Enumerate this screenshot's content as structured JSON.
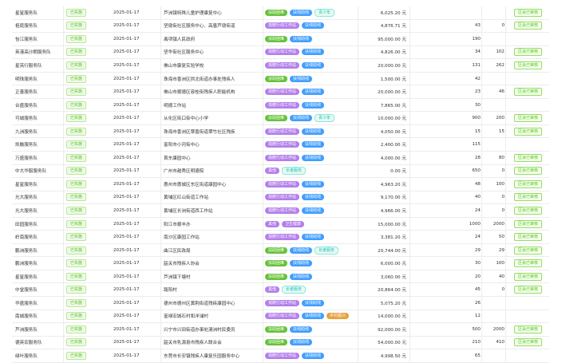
{
  "colors": {
    "status": "#52c41a",
    "tag_green": "#67c23a",
    "tag_blue": "#409eff",
    "tag_purple": "#b37feb",
    "tag_gold": "#e6a23c"
  },
  "rows": [
    {
      "team": "星星服务队",
      "status": "已实施",
      "date": "2025-01-17",
      "org": "芦洲镇特殊儿童护理康复中心",
      "tags": [
        {
          "text": "扶助困难",
          "c": "green"
        },
        {
          "text": "扶残助残",
          "c": "blue"
        },
        {
          "text": "青少年",
          "c": "teal"
        }
      ],
      "amount": "6,025.20 元",
      "n1": "",
      "n2": "",
      "action": "区会已审核"
    },
    {
      "team": "祖庭服务队",
      "status": "已实施",
      "date": "2025-01-17",
      "org": "坚墩街社区服务中心、高唐芦墩街道",
      "tags": [
        {
          "text": "捐赠行动工作站",
          "c": "purple"
        },
        {
          "text": "扶残助残",
          "c": "blue"
        }
      ],
      "amount": "4,876.71 元",
      "n1": "43",
      "n2": "0",
      "action": "区会已审核"
    },
    {
      "team": "怡江服务队",
      "status": "已实施",
      "date": "2025-01-17",
      "org": "禹项镇人民政府",
      "tags": [
        {
          "text": "扶助困难",
          "c": "green"
        },
        {
          "text": "扶残助残",
          "c": "blue"
        }
      ],
      "amount": "95,000.00 元",
      "n1": "190",
      "n2": "",
      "action": ""
    },
    {
      "team": "英港高沙朗服务队",
      "status": "已实施",
      "date": "2025-01-17",
      "org": "坚华街社区服务中心",
      "tags": [
        {
          "text": "捐赠行动工作站",
          "c": "purple"
        },
        {
          "text": "扶残助残",
          "c": "blue"
        }
      ],
      "amount": "4,826.00 元",
      "n1": "34",
      "n2": "102",
      "action": "区会已审核"
    },
    {
      "team": "星亮行服务队",
      "status": "已实施",
      "date": "2025-01-17",
      "org": "佛山市康复实验学校",
      "tags": [
        {
          "text": "捐赠行动工作站",
          "c": "purple"
        },
        {
          "text": "扶残助残",
          "c": "blue"
        }
      ],
      "amount": "20,000.00 元",
      "n1": "131",
      "n2": "262",
      "action": "区会已审核"
    },
    {
      "team": "明珠服务队",
      "status": "已实施",
      "date": "2025-01-17",
      "org": "珠海市香洲区拱北街道办事处残疾人",
      "tags": [
        {
          "text": "扶助困难",
          "c": "green"
        },
        {
          "text": "扶残助残",
          "c": "blue"
        }
      ],
      "amount": "1,500.00 元",
      "n1": "42",
      "n2": "",
      "action": ""
    },
    {
      "team": "正善服务队",
      "status": "已实施",
      "date": "2025-01-17",
      "org": "佛山市顺德区容桂街残疾人职能机构",
      "tags": [
        {
          "text": "捐赠行动工作站",
          "c": "purple"
        },
        {
          "text": "扶残助残",
          "c": "blue"
        }
      ],
      "amount": "20,000.00 元",
      "n1": "23",
      "n2": "46",
      "action": "区会已审核"
    },
    {
      "team": "合盛服务队",
      "status": "已实施",
      "date": "2025-01-17",
      "org": "明德工作站",
      "tags": [
        {
          "text": "捐赠行动工作站",
          "c": "purple"
        },
        {
          "text": "扶残助残",
          "c": "blue"
        }
      ],
      "amount": "7,865.00 元",
      "n1": "30",
      "n2": "",
      "action": ""
    },
    {
      "team": "可城服务队",
      "status": "已实施",
      "date": "2025-01-17",
      "org": "从化区街口街中心小学",
      "tags": [
        {
          "text": "扶助困难",
          "c": "green"
        },
        {
          "text": "扶残助残",
          "c": "blue"
        },
        {
          "text": "青少年",
          "c": "teal"
        }
      ],
      "amount": "10,000.00 元",
      "n1": "900",
      "n2": "200",
      "action": "区会已审核"
    },
    {
      "team": "九洲服务队",
      "status": "已实施",
      "date": "2025-01-17",
      "org": "珠海市香洲区翠香街道翠竹社区残疾",
      "tags": [
        {
          "text": "捐赠行动工作站",
          "c": "purple"
        },
        {
          "text": "扶残助残",
          "c": "blue"
        }
      ],
      "amount": "4,050.00 元",
      "n1": "15",
      "n2": "15",
      "action": "区会已审核"
    },
    {
      "team": "凯融服务队",
      "status": "已实施",
      "date": "2025-01-17",
      "org": "富阳市小河街中心",
      "tags": [
        {
          "text": "捐赠行动工作站",
          "c": "purple"
        },
        {
          "text": "扶残助残",
          "c": "blue"
        }
      ],
      "amount": "2,400.00 元",
      "n1": "115",
      "n2": "",
      "action": ""
    },
    {
      "team": "万盛服务队",
      "status": "已实施",
      "date": "2025-01-17",
      "org": "首东康园中心",
      "tags": [
        {
          "text": "捐赠行动工作站",
          "c": "purple"
        },
        {
          "text": "扶残助残",
          "c": "blue"
        }
      ],
      "amount": "4,000.00 元",
      "n1": "28",
      "n2": "80",
      "action": "区会已审核"
    },
    {
      "team": "中大华服服务队",
      "status": "已实施",
      "date": "2025-01-17",
      "org": "广州市越秀区明德院",
      "tags": [
        {
          "text": "其他",
          "c": "purple"
        },
        {
          "text": "长者服务",
          "c": "teal"
        }
      ],
      "amount": "0.00 元",
      "n1": "650",
      "n2": "0",
      "action": "区会已审核"
    },
    {
      "team": "星星服务队",
      "status": "已实施",
      "date": "2025-01-17",
      "org": "惠州市惠城区东区街道康园中心",
      "tags": [
        {
          "text": "捐赠行动工作站",
          "c": "purple"
        },
        {
          "text": "扶残助残",
          "c": "blue"
        }
      ],
      "amount": "4,963.20 元",
      "n1": "48",
      "n2": "100",
      "action": "区会已审核"
    },
    {
      "team": "光大服务队",
      "status": "已实施",
      "date": "2025-01-17",
      "org": "黄埔区红山街道工作站",
      "tags": [
        {
          "text": "捐赠行动工作站",
          "c": "purple"
        },
        {
          "text": "扶残助残",
          "c": "blue"
        }
      ],
      "amount": "9,170.00 元",
      "n1": "40",
      "n2": "0",
      "action": "区会已审核"
    },
    {
      "team": "光大服务队",
      "status": "已实施",
      "date": "2025-01-17",
      "org": "黄埔区长洲街道西工作站",
      "tags": [
        {
          "text": "捐赠行动工作站",
          "c": "purple"
        },
        {
          "text": "扶残助残",
          "c": "blue"
        }
      ],
      "amount": "4,966.00 元",
      "n1": "24",
      "n2": "0",
      "action": "区会已审核"
    },
    {
      "team": "田园服务队",
      "status": "已实施",
      "date": "2025-01-17",
      "org": "阳江市顺丰办",
      "tags": [
        {
          "text": "其他",
          "c": "purple"
        },
        {
          "text": "卫生健康",
          "c": "purple"
        }
      ],
      "amount": "15,000.00 元",
      "n1": "1000",
      "n2": "2000",
      "action": "区会已审核"
    },
    {
      "team": "岭南服务队",
      "status": "已实施",
      "date": "2025-01-17",
      "org": "南沙区康园工作站",
      "tags": [
        {
          "text": "捐赠行动工作站",
          "c": "purple"
        },
        {
          "text": "扶残助残",
          "c": "blue"
        }
      ],
      "amount": "3,381.20 元",
      "n1": "24",
      "n2": "50",
      "action": "区会已审核"
    },
    {
      "team": "鹏洲服务队",
      "status": "已实施",
      "date": "2025-01-17",
      "org": "曲江区民政局",
      "tags": [
        {
          "text": "扶助困难",
          "c": "green"
        },
        {
          "text": "扶残助残",
          "c": "blue"
        },
        {
          "text": "长者服务",
          "c": "teal"
        }
      ],
      "amount": "20,744.00 元",
      "n1": "29",
      "n2": "29",
      "action": "区会已审核"
    },
    {
      "team": "鹏洲服务队",
      "status": "已实施",
      "date": "2025-01-17",
      "org": "韶关市残疾人协会",
      "tags": [
        {
          "text": "扶助困难",
          "c": "green"
        },
        {
          "text": "扶残助残",
          "c": "blue"
        }
      ],
      "amount": "6,000.00 元",
      "n1": "30",
      "n2": "100",
      "action": "区会已审核"
    },
    {
      "team": "星星服务队",
      "status": "已实施",
      "date": "2025-01-17",
      "org": "芦洲镇下塘村",
      "tags": [
        {
          "text": "扶助困难",
          "c": "green"
        },
        {
          "text": "扶残助残",
          "c": "blue"
        }
      ],
      "amount": "3,060.00 元",
      "n1": "20",
      "n2": "40",
      "action": "区会已审核"
    },
    {
      "team": "中堂服务队",
      "status": "已实施",
      "date": "2025-01-17",
      "org": "路阳村",
      "tags": [
        {
          "text": "其他",
          "c": "purple"
        },
        {
          "text": "长者服务",
          "c": "teal"
        }
      ],
      "amount": "20,864.00 元",
      "n1": "45",
      "n2": "0",
      "action": "区会已审核"
    },
    {
      "team": "华盛服务队",
      "status": "已实施",
      "date": "2025-01-17",
      "org": "德州市德州区黄荆街道残疾康园中心",
      "tags": [
        {
          "text": "捐赠行动工作站",
          "c": "purple"
        },
        {
          "text": "扶残助残",
          "c": "blue"
        }
      ],
      "amount": "5,075.20 元",
      "n1": "26",
      "n2": "",
      "action": ""
    },
    {
      "team": "南城服务队",
      "status": "已实施",
      "date": "2025-01-17",
      "org": "富禄宏城石村和洋浦村",
      "tags": [
        {
          "text": "捐赠行动工作站",
          "c": "purple"
        },
        {
          "text": "扶残助残",
          "c": "blue"
        },
        {
          "text": "乡村振兴",
          "c": "gold"
        }
      ],
      "amount": "14,000.00 元",
      "n1": "12",
      "n2": "",
      "action": ""
    },
    {
      "team": "芦洲服务队",
      "status": "已实施",
      "date": "2025-01-17",
      "org": "兴宁市兴田街道办事处澳洲村民委员",
      "tags": [
        {
          "text": "扶助困难",
          "c": "green"
        },
        {
          "text": "扶残助残",
          "c": "blue"
        }
      ],
      "amount": "92,000.00 元",
      "n1": "500",
      "n2": "2000",
      "action": "区会已审核"
    },
    {
      "team": "德英宏服务队",
      "status": "已实施",
      "date": "2025-01-17",
      "org": "韶关市乳源县市残疾人联合会",
      "tags": [
        {
          "text": "扶助困难",
          "c": "green"
        },
        {
          "text": "扶残助残",
          "c": "blue"
        }
      ],
      "amount": "54,000.00 元",
      "n1": "210",
      "n2": "410",
      "action": "区会已审核"
    },
    {
      "team": "绿叶服务队",
      "status": "已实施",
      "date": "2025-01-17",
      "org": "东莞市长安镇残疾人康复乐园服务中心",
      "tags": [
        {
          "text": "捐赠行动工作站",
          "c": "purple"
        },
        {
          "text": "扶残助残",
          "c": "blue"
        }
      ],
      "amount": "4,998.50 元",
      "n1": "65",
      "n2": "",
      "action": ""
    }
  ]
}
